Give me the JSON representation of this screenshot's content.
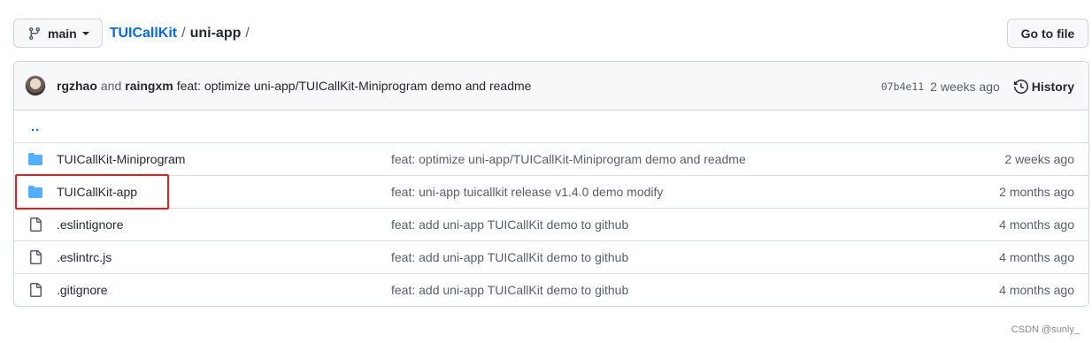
{
  "header": {
    "branch": "main",
    "breadcrumb": {
      "repo": "TUICallKit",
      "sep1": "/",
      "folder": "uni-app",
      "sep2": "/"
    },
    "goto_file": "Go to file"
  },
  "commit": {
    "author1": "rgzhao",
    "and": "and",
    "author2": "raingxm",
    "message": "feat: optimize uni-app/TUICallKit-Miniprogram demo and readme",
    "sha": "07b4e11",
    "date": "2 weeks ago",
    "history": "History"
  },
  "parent_link": "..",
  "files": [
    {
      "type": "folder",
      "name": "TUICallKit-Miniprogram",
      "message": "feat: optimize uni-app/TUICallKit-Miniprogram demo and readme",
      "age": "2 weeks ago"
    },
    {
      "type": "folder",
      "name": "TUICallKit-app",
      "message": "feat: uni-app tuicallkit release v1.4.0 demo modify",
      "age": "2 months ago"
    },
    {
      "type": "file",
      "name": ".eslintignore",
      "message": "feat: add uni-app TUICallKit demo to github",
      "age": "4 months ago"
    },
    {
      "type": "file",
      "name": ".eslintrc.js",
      "message": "feat: add uni-app TUICallKit demo to github",
      "age": "4 months ago"
    },
    {
      "type": "file",
      "name": ".gitignore",
      "message": "feat: add uni-app TUICallKit demo to github",
      "age": "4 months ago"
    }
  ],
  "colors": {
    "link": "#0969da",
    "folder": "#54aeff",
    "highlight": "#e02020"
  },
  "watermark": "CSDN @sunly_"
}
